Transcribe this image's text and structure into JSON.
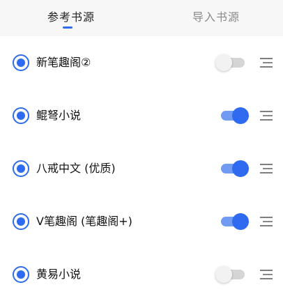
{
  "tabs": [
    {
      "label": "参考书源",
      "active": true
    },
    {
      "label": "导入书源",
      "active": false
    }
  ],
  "colors": {
    "accent": "#2e6bf0",
    "accent_light": "#6f9cf2",
    "inactive_track": "#d5d5d5"
  },
  "sources": [
    {
      "name": "新笔趣阁②",
      "selected": true,
      "enabled": false
    },
    {
      "name": "鲲弩小说",
      "selected": true,
      "enabled": true
    },
    {
      "name": "八戒中文 (优质)",
      "selected": true,
      "enabled": true
    },
    {
      "name": "V笔趣阁 (笔趣阁+)",
      "selected": true,
      "enabled": true
    },
    {
      "name": "黄易小说",
      "selected": true,
      "enabled": false
    }
  ],
  "icons": {
    "radio": "radio-checked-icon",
    "drag": "drag-handle-icon"
  }
}
